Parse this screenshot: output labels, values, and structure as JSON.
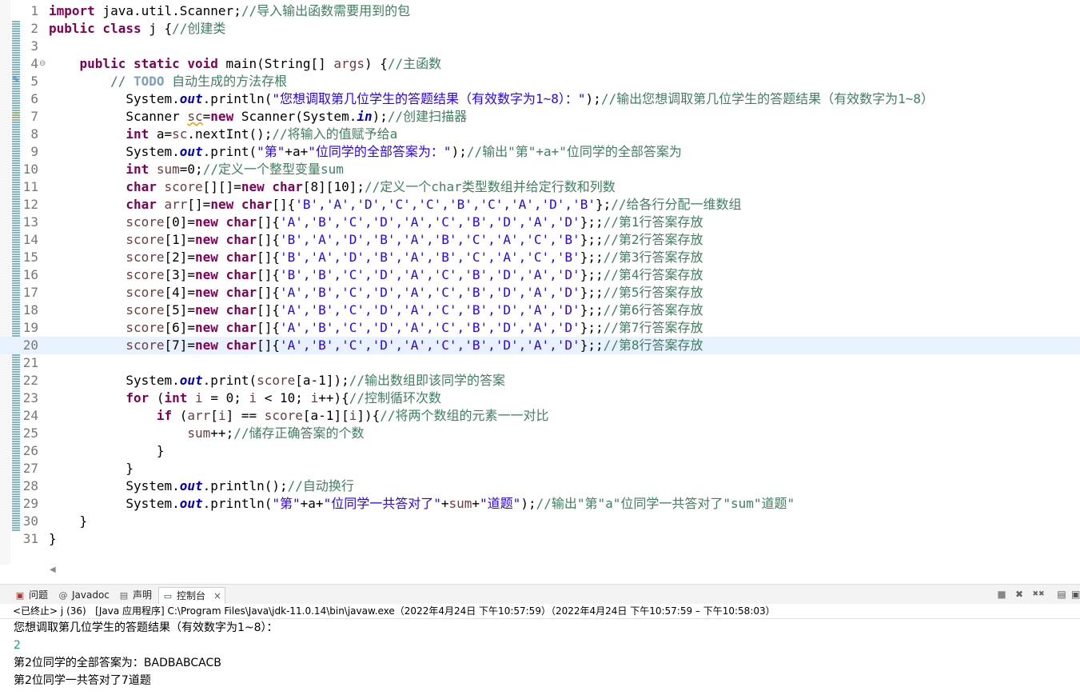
{
  "editor": {
    "lines": [
      {
        "n": "1",
        "segs": [
          {
            "t": "import",
            "c": "kw"
          },
          {
            "t": " java.util.Scanner;"
          },
          {
            "t": "//导入输出函数需要用到的包",
            "c": "cm"
          }
        ]
      },
      {
        "n": "2",
        "segs": [
          {
            "t": "public class",
            "c": "kw"
          },
          {
            "t": " j {"
          },
          {
            "t": "//创建类",
            "c": "cm"
          }
        ]
      },
      {
        "n": "3",
        "segs": []
      },
      {
        "n": "4",
        "fold": true,
        "segs": [
          {
            "t": "    "
          },
          {
            "t": "public static void",
            "c": "kw"
          },
          {
            "t": " main(String[] "
          },
          {
            "t": "args",
            "c": "var"
          },
          {
            "t": ") {"
          },
          {
            "t": "//主函数",
            "c": "cm"
          }
        ]
      },
      {
        "n": "5",
        "segs": [
          {
            "t": "        "
          },
          {
            "t": "// ",
            "c": "cm"
          },
          {
            "t": "TODO",
            "c": "todo"
          },
          {
            "t": " 自动生成的方法存根",
            "c": "cm"
          }
        ]
      },
      {
        "n": "6",
        "segs": [
          {
            "t": "          System."
          },
          {
            "t": "out",
            "c": "fld"
          },
          {
            "t": ".println("
          },
          {
            "t": "\"您想调取第几位学生的答题结果（有效数字为1~8）：\"",
            "c": "str"
          },
          {
            "t": ");"
          },
          {
            "t": "//输出您想调取第几位学生的答题结果（有效数字为1~8）",
            "c": "cm"
          }
        ]
      },
      {
        "n": "7",
        "segs": [
          {
            "t": "          Scanner "
          },
          {
            "t": "sc",
            "c": "var squig"
          },
          {
            "t": "="
          },
          {
            "t": "new",
            "c": "kw"
          },
          {
            "t": " Scanner(System."
          },
          {
            "t": "in",
            "c": "fld"
          },
          {
            "t": ");"
          },
          {
            "t": "//创建扫描器",
            "c": "cm"
          }
        ]
      },
      {
        "n": "8",
        "segs": [
          {
            "t": "          "
          },
          {
            "t": "int",
            "c": "kw"
          },
          {
            "t": " a="
          },
          {
            "t": "sc",
            "c": "var"
          },
          {
            "t": ".nextInt();"
          },
          {
            "t": "//将输入的值赋予给a",
            "c": "cm"
          }
        ]
      },
      {
        "n": "9",
        "segs": [
          {
            "t": "          System."
          },
          {
            "t": "out",
            "c": "fld"
          },
          {
            "t": ".print("
          },
          {
            "t": "\"第\"",
            "c": "str"
          },
          {
            "t": "+a+"
          },
          {
            "t": "\"位同学的全部答案为：\"",
            "c": "str"
          },
          {
            "t": ");"
          },
          {
            "t": "//输出\"第\"+a+\"位同学的全部答案为",
            "c": "cm"
          }
        ]
      },
      {
        "n": "10",
        "segs": [
          {
            "t": "          "
          },
          {
            "t": "int",
            "c": "kw"
          },
          {
            "t": " "
          },
          {
            "t": "sum",
            "c": "var"
          },
          {
            "t": "=0;"
          },
          {
            "t": "//定义一个整型变量sum",
            "c": "cm"
          }
        ]
      },
      {
        "n": "11",
        "segs": [
          {
            "t": "          "
          },
          {
            "t": "char",
            "c": "kw"
          },
          {
            "t": " "
          },
          {
            "t": "score",
            "c": "var"
          },
          {
            "t": "[][]="
          },
          {
            "t": "new char",
            "c": "kw"
          },
          {
            "t": "[8][10];"
          },
          {
            "t": "//定义一个char类型数组并给定行数和列数",
            "c": "cm"
          }
        ]
      },
      {
        "n": "12",
        "segs": [
          {
            "t": "          "
          },
          {
            "t": "char",
            "c": "kw"
          },
          {
            "t": " "
          },
          {
            "t": "arr",
            "c": "var"
          },
          {
            "t": "[]="
          },
          {
            "t": "new char",
            "c": "kw"
          },
          {
            "t": "[]{"
          },
          {
            "t": "'B','A','D','C','C','B','C','A','D','B'",
            "c": "str"
          },
          {
            "t": "};"
          },
          {
            "t": "//给各行分配一维数组",
            "c": "cm"
          }
        ]
      },
      {
        "n": "13",
        "segs": [
          {
            "t": "          "
          },
          {
            "t": "score",
            "c": "var"
          },
          {
            "t": "[0]="
          },
          {
            "t": "new char",
            "c": "kw"
          },
          {
            "t": "[]{"
          },
          {
            "t": "'A','B','C','D','A','C','B','D','A','D'",
            "c": "str"
          },
          {
            "t": "};;"
          },
          {
            "t": "//第1行答案存放",
            "c": "cm"
          }
        ]
      },
      {
        "n": "14",
        "segs": [
          {
            "t": "          "
          },
          {
            "t": "score",
            "c": "var"
          },
          {
            "t": "[1]="
          },
          {
            "t": "new char",
            "c": "kw"
          },
          {
            "t": "[]{"
          },
          {
            "t": "'B','A','D','B','A','B','C','A','C','B'",
            "c": "str"
          },
          {
            "t": "};;"
          },
          {
            "t": "//第2行答案存放",
            "c": "cm"
          }
        ]
      },
      {
        "n": "15",
        "segs": [
          {
            "t": "          "
          },
          {
            "t": "score",
            "c": "var"
          },
          {
            "t": "[2]="
          },
          {
            "t": "new char",
            "c": "kw"
          },
          {
            "t": "[]{"
          },
          {
            "t": "'B','A','D','B','A','B','C','A','C','B'",
            "c": "str"
          },
          {
            "t": "};;"
          },
          {
            "t": "//第3行答案存放",
            "c": "cm"
          }
        ]
      },
      {
        "n": "16",
        "segs": [
          {
            "t": "          "
          },
          {
            "t": "score",
            "c": "var"
          },
          {
            "t": "[3]="
          },
          {
            "t": "new char",
            "c": "kw"
          },
          {
            "t": "[]{"
          },
          {
            "t": "'B','B','C','D','A','C','B','D','A','D'",
            "c": "str"
          },
          {
            "t": "};;"
          },
          {
            "t": "//第4行答案存放",
            "c": "cm"
          }
        ]
      },
      {
        "n": "17",
        "segs": [
          {
            "t": "          "
          },
          {
            "t": "score",
            "c": "var"
          },
          {
            "t": "[4]="
          },
          {
            "t": "new char",
            "c": "kw"
          },
          {
            "t": "[]{"
          },
          {
            "t": "'A','B','C','D','A','C','B','D','A','D'",
            "c": "str"
          },
          {
            "t": "};;"
          },
          {
            "t": "//第5行答案存放",
            "c": "cm"
          }
        ]
      },
      {
        "n": "18",
        "segs": [
          {
            "t": "          "
          },
          {
            "t": "score",
            "c": "var"
          },
          {
            "t": "[5]="
          },
          {
            "t": "new char",
            "c": "kw"
          },
          {
            "t": "[]{"
          },
          {
            "t": "'A','B','C','D','A','C','B','D','A','D'",
            "c": "str"
          },
          {
            "t": "};;"
          },
          {
            "t": "//第6行答案存放",
            "c": "cm"
          }
        ]
      },
      {
        "n": "19",
        "segs": [
          {
            "t": "          "
          },
          {
            "t": "score",
            "c": "var"
          },
          {
            "t": "[6]="
          },
          {
            "t": "new char",
            "c": "kw"
          },
          {
            "t": "[]{"
          },
          {
            "t": "'A','B','C','D','A','C','B','D','A','D'",
            "c": "str"
          },
          {
            "t": "};;"
          },
          {
            "t": "//第7行答案存放",
            "c": "cm"
          }
        ]
      },
      {
        "n": "20",
        "current": true,
        "segs": [
          {
            "t": "          "
          },
          {
            "t": "score",
            "c": "var"
          },
          {
            "t": "[7]="
          },
          {
            "t": "new char",
            "c": "kw"
          },
          {
            "t": "[]{"
          },
          {
            "t": "'A','B','C','D','A','C','B','D','A','D'",
            "c": "str"
          },
          {
            "t": "};;"
          },
          {
            "t": "//第8行答案存放",
            "c": "cm"
          }
        ]
      },
      {
        "n": "21",
        "segs": []
      },
      {
        "n": "22",
        "segs": [
          {
            "t": "          System."
          },
          {
            "t": "out",
            "c": "fld"
          },
          {
            "t": ".print("
          },
          {
            "t": "score",
            "c": "var"
          },
          {
            "t": "[a-1]);"
          },
          {
            "t": "//输出数组即该同学的答案",
            "c": "cm"
          }
        ]
      },
      {
        "n": "23",
        "segs": [
          {
            "t": "          "
          },
          {
            "t": "for",
            "c": "kw"
          },
          {
            "t": " ("
          },
          {
            "t": "int",
            "c": "kw"
          },
          {
            "t": " "
          },
          {
            "t": "i",
            "c": "var"
          },
          {
            "t": " = 0; "
          },
          {
            "t": "i",
            "c": "var"
          },
          {
            "t": " < 10; "
          },
          {
            "t": "i",
            "c": "var"
          },
          {
            "t": "++){"
          },
          {
            "t": "//控制循环次数",
            "c": "cm"
          }
        ]
      },
      {
        "n": "24",
        "segs": [
          {
            "t": "              "
          },
          {
            "t": "if",
            "c": "kw"
          },
          {
            "t": " ("
          },
          {
            "t": "arr",
            "c": "var"
          },
          {
            "t": "["
          },
          {
            "t": "i",
            "c": "var"
          },
          {
            "t": "] == "
          },
          {
            "t": "score",
            "c": "var"
          },
          {
            "t": "[a-1]["
          },
          {
            "t": "i",
            "c": "var"
          },
          {
            "t": "]){"
          },
          {
            "t": "//将两个数组的元素一一对比",
            "c": "cm"
          }
        ]
      },
      {
        "n": "25",
        "segs": [
          {
            "t": "                  "
          },
          {
            "t": "sum",
            "c": "var"
          },
          {
            "t": "++;"
          },
          {
            "t": "//储存正确答案的个数",
            "c": "cm"
          }
        ]
      },
      {
        "n": "26",
        "segs": [
          {
            "t": "              }"
          }
        ]
      },
      {
        "n": "27",
        "segs": [
          {
            "t": "          }"
          }
        ]
      },
      {
        "n": "28",
        "segs": [
          {
            "t": "          System."
          },
          {
            "t": "out",
            "c": "fld"
          },
          {
            "t": ".println();"
          },
          {
            "t": "//自动换行",
            "c": "cm"
          }
        ]
      },
      {
        "n": "29",
        "segs": [
          {
            "t": "          System."
          },
          {
            "t": "out",
            "c": "fld"
          },
          {
            "t": ".println("
          },
          {
            "t": "\"第\"",
            "c": "str"
          },
          {
            "t": "+a+"
          },
          {
            "t": "\"位同学一共答对了\"",
            "c": "str"
          },
          {
            "t": "+"
          },
          {
            "t": "sum",
            "c": "var"
          },
          {
            "t": "+"
          },
          {
            "t": "\"道题\"",
            "c": "str"
          },
          {
            "t": ");"
          },
          {
            "t": "//输出\"第\"a\"位同学一共答对了\"sum\"道题\"",
            "c": "cm"
          }
        ]
      },
      {
        "n": "30",
        "segs": [
          {
            "t": "    }"
          }
        ]
      },
      {
        "n": "31",
        "segs": [
          {
            "t": "}"
          }
        ]
      }
    ]
  },
  "tabs": {
    "problems": {
      "label": "问题",
      "icon": "problems-icon"
    },
    "javadoc": {
      "label": "Javadoc",
      "icon": "at-icon"
    },
    "declaration": {
      "label": "声明",
      "icon": "declaration-icon"
    },
    "console": {
      "label": "控制台",
      "icon": "console-icon",
      "close": "×"
    }
  },
  "toolbar": {
    "terminate": "■",
    "remove": "✖",
    "remove_all": "✖✖",
    "pin": "▤",
    "open_console": "▣"
  },
  "console": {
    "status": "<已终止> j (36)   [Java 应用程序] C:\\Program Files\\Java\\jdk-11.0.14\\bin\\javaw.exe（2022年4月24日 下午10:57:59）（2022年4月24日 下午10:57:59 – 下午10:58:03）",
    "lines": [
      {
        "text": "您想调取第几位学生的答题结果（有效数字为1~8）：",
        "input": false
      },
      {
        "text": "2",
        "input": true
      },
      {
        "text": "第2位同学的全部答案为：BADBABCACB",
        "input": false
      },
      {
        "text": "第2位同学一共答对了7道题",
        "input": false
      }
    ]
  }
}
